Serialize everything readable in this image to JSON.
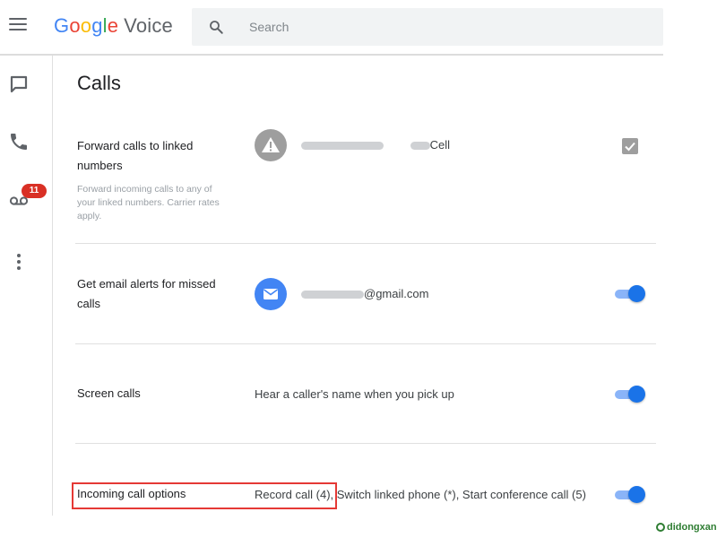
{
  "header": {
    "brand_google": [
      "G",
      "o",
      "o",
      "g",
      "l",
      "e"
    ],
    "brand_voice": "Voice",
    "search_placeholder": "Search"
  },
  "rail": {
    "items": [
      {
        "name": "messages",
        "icon": "message-icon"
      },
      {
        "name": "calls",
        "icon": "phone-icon"
      },
      {
        "name": "voicemail",
        "icon": "voicemail-icon",
        "badge": "11"
      },
      {
        "name": "more",
        "icon": "more-vert-icon"
      }
    ]
  },
  "page": {
    "title": "Calls"
  },
  "settings": [
    {
      "label": "Forward calls to linked numbers",
      "label_lines": [
        "Forward calls to linked",
        "numbers"
      ],
      "sublabel_lines": [
        "Forward incoming calls to any of",
        "your linked numbers. Carrier rates",
        "apply."
      ],
      "value_suffix": "Cell",
      "control": "checkbox",
      "checked": true,
      "icon": "warning-icon"
    },
    {
      "label": "Get email alerts for missed calls",
      "label_lines": [
        "Get email alerts for missed",
        "calls"
      ],
      "value_suffix": "@gmail.com",
      "control": "toggle",
      "enabled": true,
      "icon": "mail-icon"
    },
    {
      "label": "Screen calls",
      "value": "Hear a caller's name when you pick up",
      "control": "toggle",
      "enabled": true
    },
    {
      "label": "Incoming call options",
      "value": "Record call (4), Switch linked phone (*), Start conference call (5)",
      "control": "toggle",
      "enabled": true,
      "highlighted": true
    }
  ],
  "colors": {
    "accent": "#1a73e8",
    "toggle_track": "#8ab4f8",
    "badge": "#d93025",
    "highlight": "#e53935"
  },
  "watermark": "didongxanh"
}
